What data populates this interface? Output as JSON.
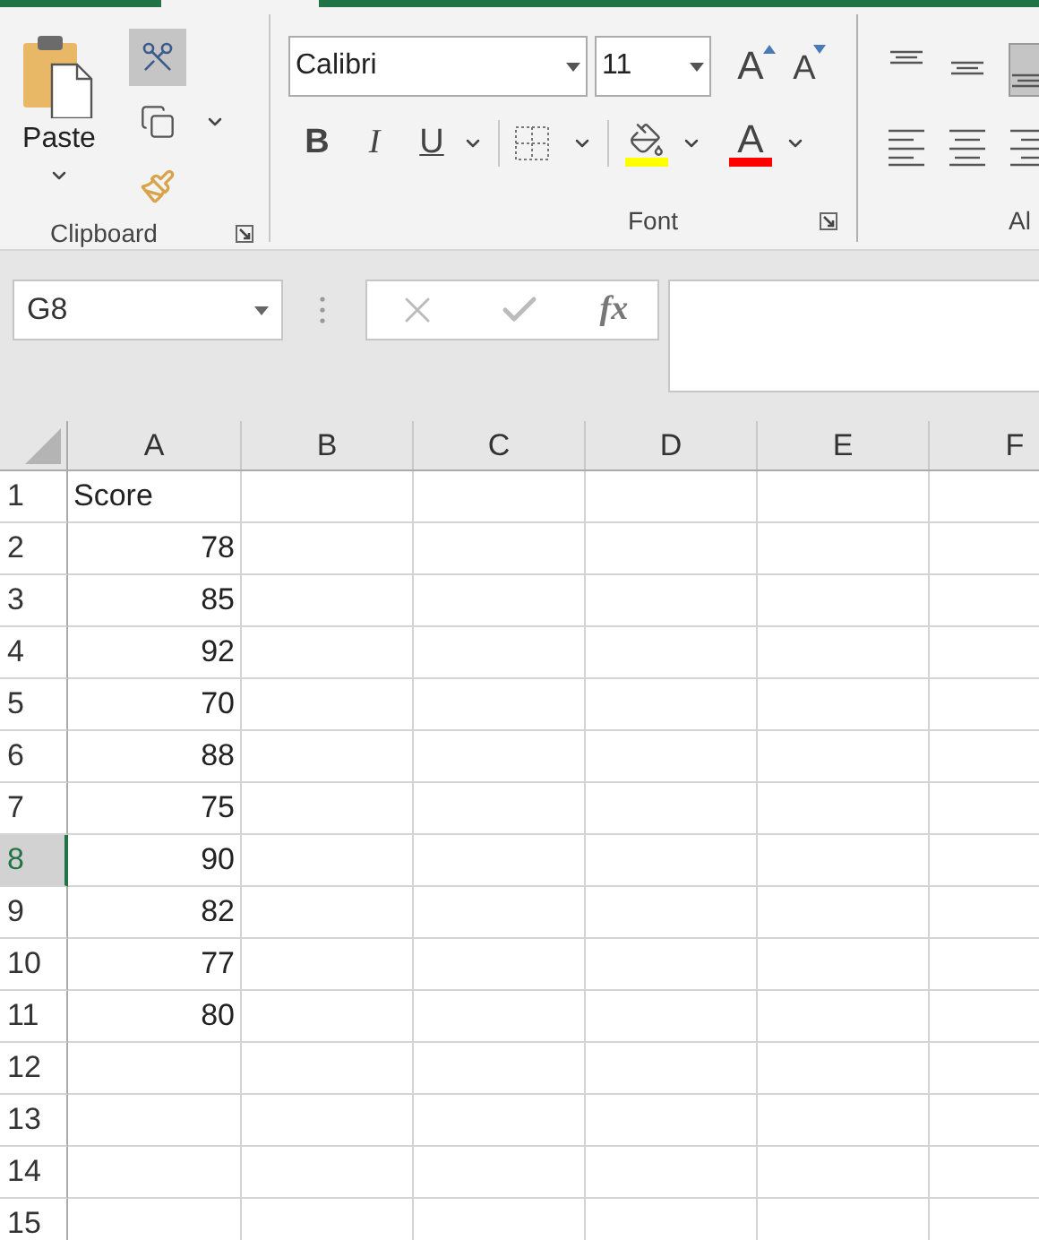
{
  "ribbon": {
    "clipboard": {
      "label": "Clipboard",
      "paste": {
        "label": "Paste"
      },
      "tools": [
        {
          "kind": "cut",
          "selected": true
        },
        {
          "kind": "copy",
          "selected": false
        },
        {
          "kind": "painter",
          "selected": false
        }
      ]
    },
    "font": {
      "label": "Font",
      "font_name": "Calibri",
      "font_size": "11",
      "grow": "A",
      "shrink": "A",
      "styles": [
        {
          "kind": "bold",
          "label": "B"
        },
        {
          "kind": "italic",
          "label": "I"
        },
        {
          "kind": "underline",
          "label": "U"
        }
      ],
      "fill_color": {
        "color": "#ffff00"
      },
      "font_color": {
        "label": "A",
        "color": "#ff0000"
      }
    },
    "alignment": {
      "label": "Al",
      "top_row": [
        {
          "kind": "top",
          "selected": false
        },
        {
          "kind": "middle",
          "selected": false
        },
        {
          "kind": "bottom",
          "selected": true
        }
      ],
      "bottom_row": [
        {
          "kind": "left"
        },
        {
          "kind": "center"
        },
        {
          "kind": "right"
        }
      ]
    }
  },
  "name_box": "G8",
  "formula_bar": {
    "fx": "fx"
  },
  "columns": [
    "A",
    "B",
    "C",
    "D",
    "E",
    "F"
  ],
  "rows": [
    {
      "header": "1",
      "selected": false,
      "value": "Score",
      "kind": "text"
    },
    {
      "header": "2",
      "selected": false,
      "value": "78",
      "kind": "number"
    },
    {
      "header": "3",
      "selected": false,
      "value": "85",
      "kind": "number"
    },
    {
      "header": "4",
      "selected": false,
      "value": "92",
      "kind": "number"
    },
    {
      "header": "5",
      "selected": false,
      "value": "70",
      "kind": "number"
    },
    {
      "header": "6",
      "selected": false,
      "value": "88",
      "kind": "number"
    },
    {
      "header": "7",
      "selected": false,
      "value": "75",
      "kind": "number"
    },
    {
      "header": "8",
      "selected": true,
      "value": "90",
      "kind": "number"
    },
    {
      "header": "9",
      "selected": false,
      "value": "82",
      "kind": "number"
    },
    {
      "header": "10",
      "selected": false,
      "value": "77",
      "kind": "number"
    },
    {
      "header": "11",
      "selected": false,
      "value": "80",
      "kind": "number"
    },
    {
      "header": "12",
      "selected": false
    },
    {
      "header": "13",
      "selected": false
    },
    {
      "header": "14",
      "selected": false
    },
    {
      "header": "15",
      "selected": false
    }
  ]
}
